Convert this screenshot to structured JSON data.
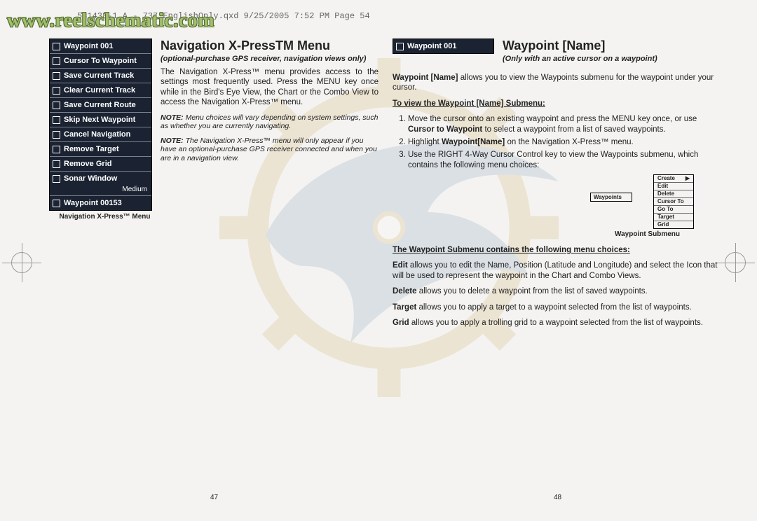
{
  "header": "531438-1_A - 737_EnglishOnly.qxd  9/25/2005  7:52 PM  Page 54",
  "watermark": "www.reelschematic.com",
  "left": {
    "title": "Navigation X-PressTM Menu",
    "subtitle": "(optional-purchase GPS receiver, navigation views only)",
    "menu": {
      "items": [
        "Waypoint 001",
        "Cursor To Waypoint",
        "Save Current Track",
        "Clear Current Track",
        "Save Current Route",
        "Skip Next Waypoint",
        "Cancel Navigation",
        "Remove Target",
        "Remove Grid",
        "Sonar Window"
      ],
      "sub": "Medium",
      "last": "Waypoint 00153",
      "caption": "Navigation X-Press™ Menu"
    },
    "p1a": "The Navigation X-Press™ menu provides access to the settings most frequently used.  Press the MENU key once while in the Bird's Eye View, the Chart or the Combo View to access the Navigation X-Press™ menu.",
    "note1_label": "NOTE:",
    "note1": " Menu choices will vary depending on system settings, such as whether you are currently navigating.",
    "note2_label": "NOTE:",
    "note2": " The Navigation X-Press™ menu will only appear if you have an optional-purchase GPS receiver connected and when you are in a navigation view."
  },
  "right": {
    "title": "Waypoint [Name]",
    "subtitle": "(Only with an active cursor on a waypoint)",
    "menu_label": "Waypoint 001",
    "intro_bold": "Waypoint [Name]",
    "intro_rest": " allows you to view the Waypoints submenu for the waypoint under your cursor.",
    "view_heading": "To view the Waypoint [Name] Submenu:",
    "step1a": "Move the cursor onto an existing waypoint and press the MENU key once, or use ",
    "step1b": "Cursor to Waypoint",
    "step1c": " to select a waypoint from a list of saved waypoints.",
    "step2a": "Highlight ",
    "step2b": "Waypoint[Name]",
    "step2c": " on the Navigation X-Press™ menu.",
    "step3": "Use the RIGHT 4-Way Cursor Control key to view the Waypoints submenu, which contains the following menu choices:",
    "wp_box_label": "Waypoints",
    "submenu": [
      "Create",
      "Edit",
      "Delete",
      "Cursor To",
      "Go To",
      "Target",
      "Grid"
    ],
    "submenu_caption": "Waypoint Submenu",
    "contains_heading": "The Waypoint Submenu contains the following menu choices:",
    "edit_bold": "Edit",
    "edit_rest": " allows you to edit the Name, Position (Latitude and Longitude) and select the Icon that will be used to represent the waypoint in the Chart and Combo Views.",
    "delete_bold": "Delete",
    "delete_rest": " allows you to delete a waypoint from the list of saved waypoints.",
    "target_bold": "Target",
    "target_rest": " allows you to apply a target to a waypoint selected from the list of waypoints.",
    "grid_bold": "Grid",
    "grid_rest": " allows you to apply a trolling grid to a waypoint selected from the list of waypoints."
  },
  "pagenum_left": "47",
  "pagenum_right": "48"
}
